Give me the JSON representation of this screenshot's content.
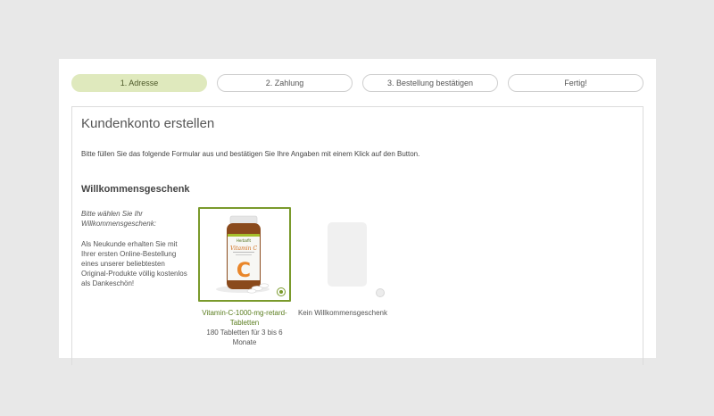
{
  "steps": [
    {
      "label": "1. Adresse",
      "active": true
    },
    {
      "label": "2. Zahlung",
      "active": false
    },
    {
      "label": "3. Bestellung bestätigen",
      "active": false
    },
    {
      "label": "Fertig!",
      "active": false
    }
  ],
  "page": {
    "title": "Kundenkonto erstellen",
    "intro": "Bitte füllen Sie das folgende Formular aus und bestätigen Sie Ihre Angaben mit einem Klick auf den Button."
  },
  "welcome": {
    "title": "Willkommensgeschenk",
    "prompt": "Bitte wählen Sie Ihr Willkommensgeschenk:",
    "description": "Als Neukunde erhalten Sie mit Ihrer ersten Online-Bestellung eines unserer beliebtesten Original-Produkte völlig kostenlos als Dankeschön!",
    "options": [
      {
        "name": "Vitamin-C-1000-mg-retard-Tabletten",
        "detail": "180 Tabletten für 3 bis 6 Monate",
        "selected": true,
        "product_label": {
          "brand": "Herbafit",
          "name": "Vitamin C",
          "letter": "C"
        }
      },
      {
        "name": "Kein Willkommensgeschenk",
        "detail": "",
        "selected": false
      }
    ]
  },
  "colors": {
    "accent": "#7a9a2c",
    "active_step_bg": "#dfe9bd",
    "link_green": "#5a7d1e"
  }
}
